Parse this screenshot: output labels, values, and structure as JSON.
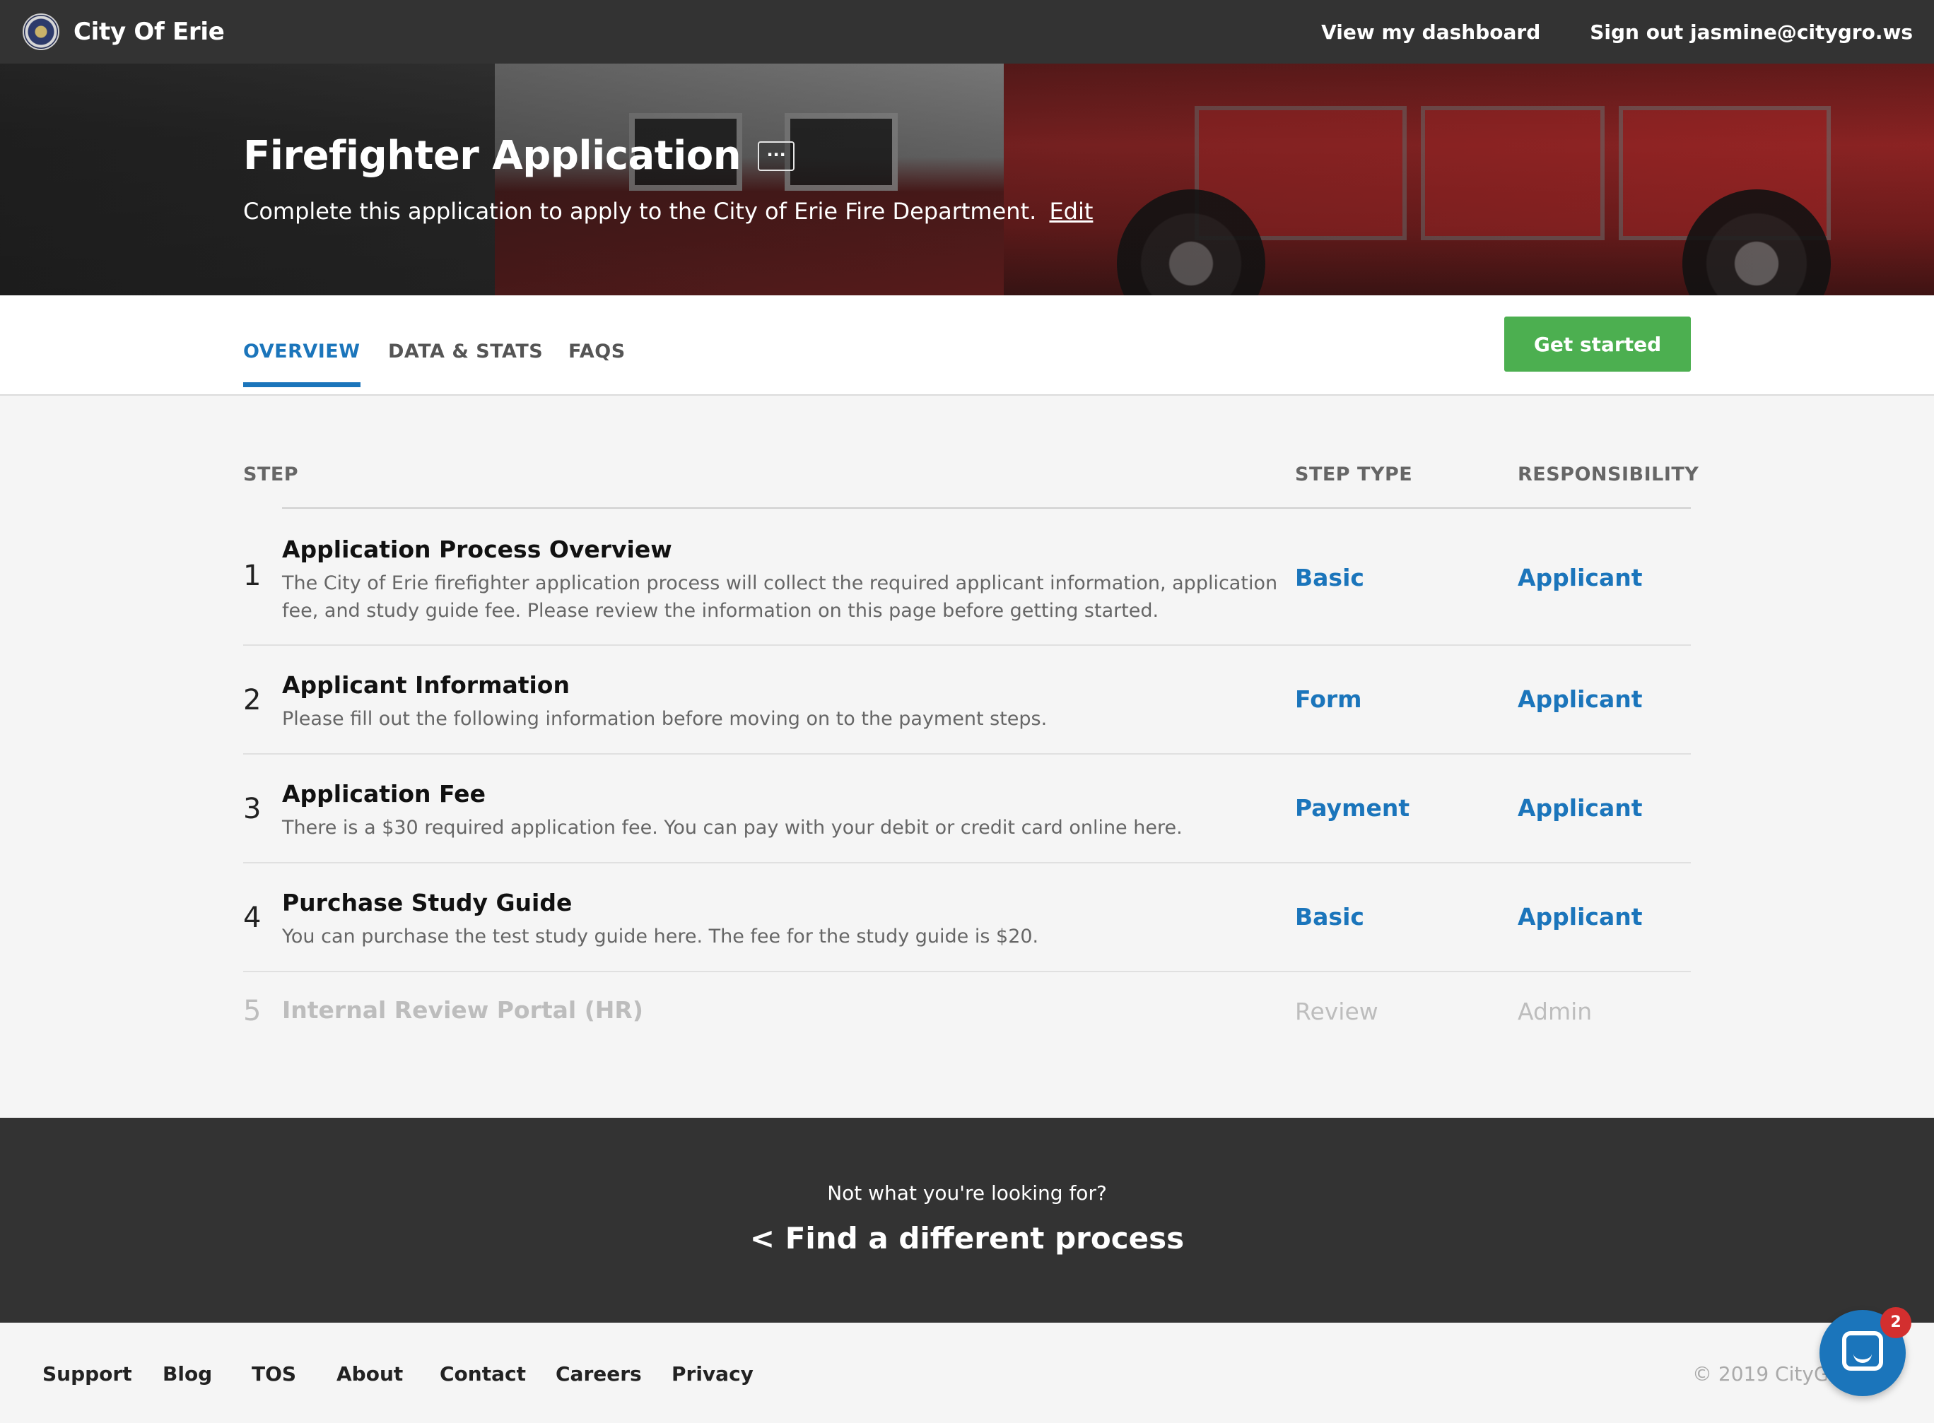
{
  "topnav": {
    "brand": "City Of Erie",
    "dashboard_link": "View my dashboard",
    "signout_link": "Sign out jasmine@citygro.ws"
  },
  "hero": {
    "title": "Firefighter Application",
    "more_button": "···",
    "subtitle": "Complete this application to apply to the City of Erie Fire Department.",
    "edit_link": "Edit"
  },
  "tabs": [
    {
      "label": "OVERVIEW",
      "active": true
    },
    {
      "label": "DATA & STATS",
      "active": false
    },
    {
      "label": "FAQS",
      "active": false
    }
  ],
  "get_started": "Get started",
  "table": {
    "headers": {
      "step": "STEP",
      "step_type": "STEP TYPE",
      "responsibility": "RESPONSIBILITY"
    },
    "rows": [
      {
        "number": "1",
        "title": "Application Process Overview",
        "description": "The City of Erie firefighter application process will collect the required applicant information, application fee, and study guide fee. Please review the information on this page before getting started.",
        "type": "Basic",
        "responsibility": "Applicant"
      },
      {
        "number": "2",
        "title": "Applicant Information",
        "description": "Please fill out the following information before moving on to the payment steps.",
        "type": "Form",
        "responsibility": "Applicant"
      },
      {
        "number": "3",
        "title": "Application Fee",
        "description": "There is a $30 required application fee. You can pay with your debit or credit card online here.",
        "type": "Payment",
        "responsibility": "Applicant"
      },
      {
        "number": "4",
        "title": "Purchase Study Guide",
        "description": "You can purchase the test study guide here. The fee for the study guide is $20.",
        "type": "Basic",
        "responsibility": "Applicant"
      },
      {
        "number": "5",
        "title": "Internal Review Portal (HR)",
        "description": "",
        "type": "Review",
        "responsibility": "Admin"
      }
    ]
  },
  "alt_band": {
    "question": "Not what you're looking for?",
    "link": "< Find a different process"
  },
  "footer": {
    "links": [
      "Support",
      "Blog",
      "TOS",
      "About",
      "Contact",
      "Careers",
      "Privacy"
    ],
    "copyright": "© 2019 CityGro"
  },
  "chat": {
    "badge_count": "2"
  },
  "colors": {
    "accent": "#1b75bb",
    "cta": "#4caf50",
    "dark": "#333333"
  }
}
